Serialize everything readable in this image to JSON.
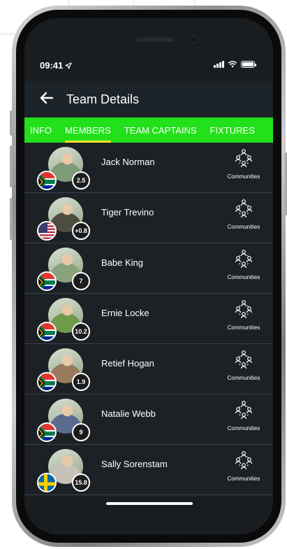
{
  "status_bar": {
    "time": "09:41"
  },
  "header": {
    "title": "Team Details"
  },
  "tabs": [
    {
      "label": "INFO",
      "active": false
    },
    {
      "label": "MEMBERS",
      "active": true
    },
    {
      "label": "TEAM CAPTAINS",
      "active": false
    },
    {
      "label": "FIXTURES",
      "active": false
    }
  ],
  "members": [
    {
      "name": "Jack Norman",
      "handicap": "2.5",
      "flag": "south-africa",
      "community_label": "Communities",
      "avatar_color": "#7f9a76"
    },
    {
      "name": "Tiger Trevino",
      "handicap": "+0.8",
      "flag": "usa",
      "community_label": "Communities",
      "avatar_color": "#4d4d3f"
    },
    {
      "name": "Babe King",
      "handicap": "7",
      "flag": "south-africa",
      "community_label": "Communities",
      "avatar_color": "#8aa27b"
    },
    {
      "name": "Ernie Locke",
      "handicap": "10.2",
      "flag": "south-africa",
      "community_label": "Communities",
      "avatar_color": "#6f9a4c"
    },
    {
      "name": "Retief Hogan",
      "handicap": "1.9",
      "flag": "south-africa",
      "community_label": "Communities",
      "avatar_color": "#9a7a5c"
    },
    {
      "name": "Natalie Webb",
      "handicap": "9",
      "flag": "south-africa",
      "community_label": "Communities",
      "avatar_color": "#5a6b8f"
    },
    {
      "name": "Sally Sorenstam",
      "handicap": "15.8",
      "flag": "sweden",
      "community_label": "Communities",
      "avatar_color": "#c7c2b8"
    }
  ],
  "colors": {
    "accent_green": "#22e01a",
    "active_tab_underline": "#f5e428",
    "background": "#1c2126"
  }
}
